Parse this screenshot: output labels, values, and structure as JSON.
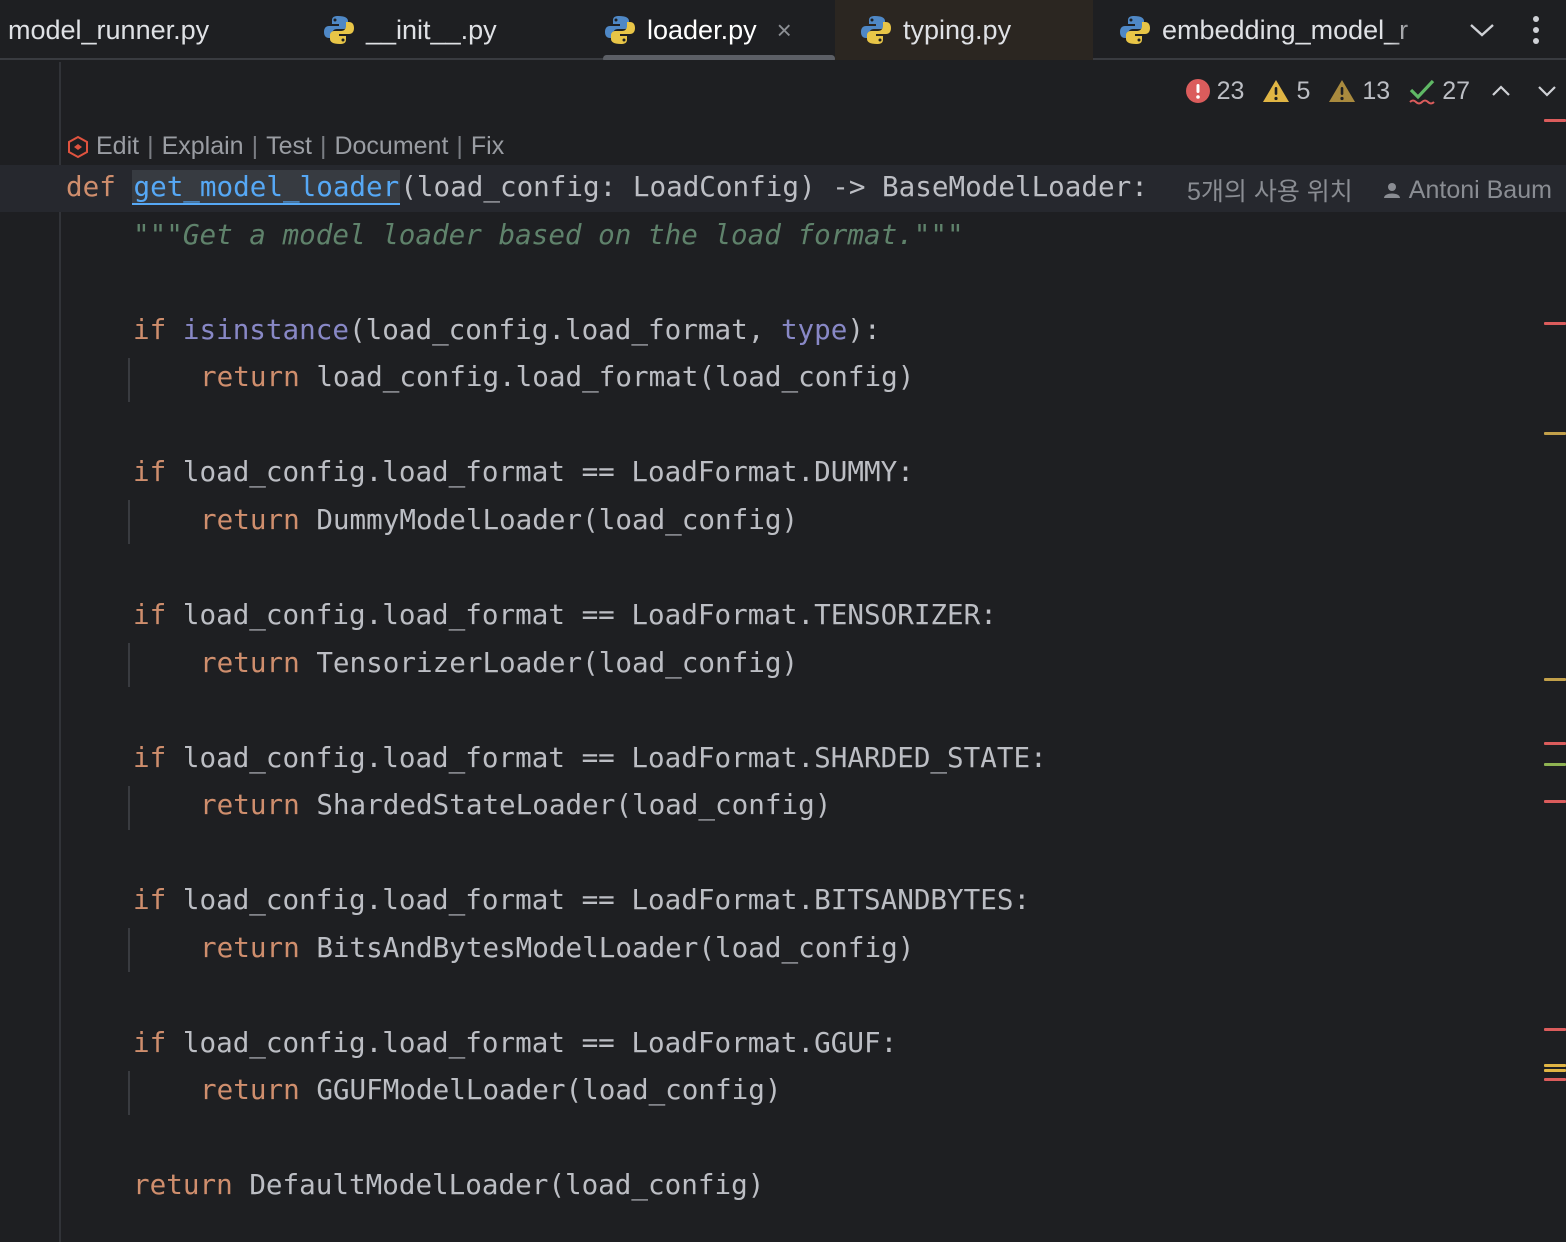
{
  "tabs": [
    {
      "label": "model_runner.py",
      "icon": "none",
      "active": false
    },
    {
      "label": "__init__.py",
      "icon": "python-icon",
      "active": false
    },
    {
      "label": "loader.py",
      "icon": "python-icon",
      "active": true,
      "close": "×"
    },
    {
      "label": "typing.py",
      "icon": "python-icon",
      "active": false
    },
    {
      "label": "embedding_model_r",
      "icon": "python-icon",
      "active": false
    }
  ],
  "inspections": {
    "errors": "23",
    "warnings": "5",
    "weak_warnings": "13",
    "typos": "27"
  },
  "codelens": {
    "edit": "Edit",
    "explain": "Explain",
    "test": "Test",
    "document": "Document",
    "fix": "Fix",
    "separator": "|"
  },
  "inlay": {
    "usages": "5개의 사용 위치",
    "author": "Antoni Baum"
  },
  "code": {
    "def_kw": "def",
    "func_name": "get_model_loader",
    "signature": "(load_config: LoadConfig) -> BaseModelLoader:",
    "docstring": "\"\"\"Get a model loader based on the load format.\"\"\"",
    "if_kw": "if",
    "return_kw": "return",
    "isinstance": "isinstance",
    "line1_mid": "(load_config.load_format, ",
    "type_kw": "type",
    "line1_end": "):",
    "line1_return": "load_config.load_format(load_config)",
    "cond_dummy": "load_config.load_format == LoadFormat.DUMMY:",
    "ret_dummy": "DummyModelLoader(load_config)",
    "cond_tensorizer": "load_config.load_format == LoadFormat.TENSORIZER:",
    "ret_tensorizer": "TensorizerLoader(load_config)",
    "cond_sharded": "load_config.load_format == LoadFormat.SHARDED_STATE:",
    "ret_sharded": "ShardedStateLoader(load_config)",
    "cond_bnb": "load_config.load_format == LoadFormat.BITSANDBYTES:",
    "ret_bnb": "BitsAndBytesModelLoader(load_config)",
    "cond_gguf": "load_config.load_format == LoadFormat.GGUF:",
    "ret_gguf": "GGUFModelLoader(load_config)",
    "final_return": "DefaultModelLoader(load_config)"
  },
  "colors": {
    "background": "#1e1f22",
    "keyword": "#cf8e6d",
    "function": "#56a8f5",
    "docstring": "#5f826b",
    "builtin": "#8888c6",
    "error": "#db5c5c",
    "warning": "#e0b544",
    "weak_warning": "#c2a04a",
    "ok": "#5fb865"
  }
}
